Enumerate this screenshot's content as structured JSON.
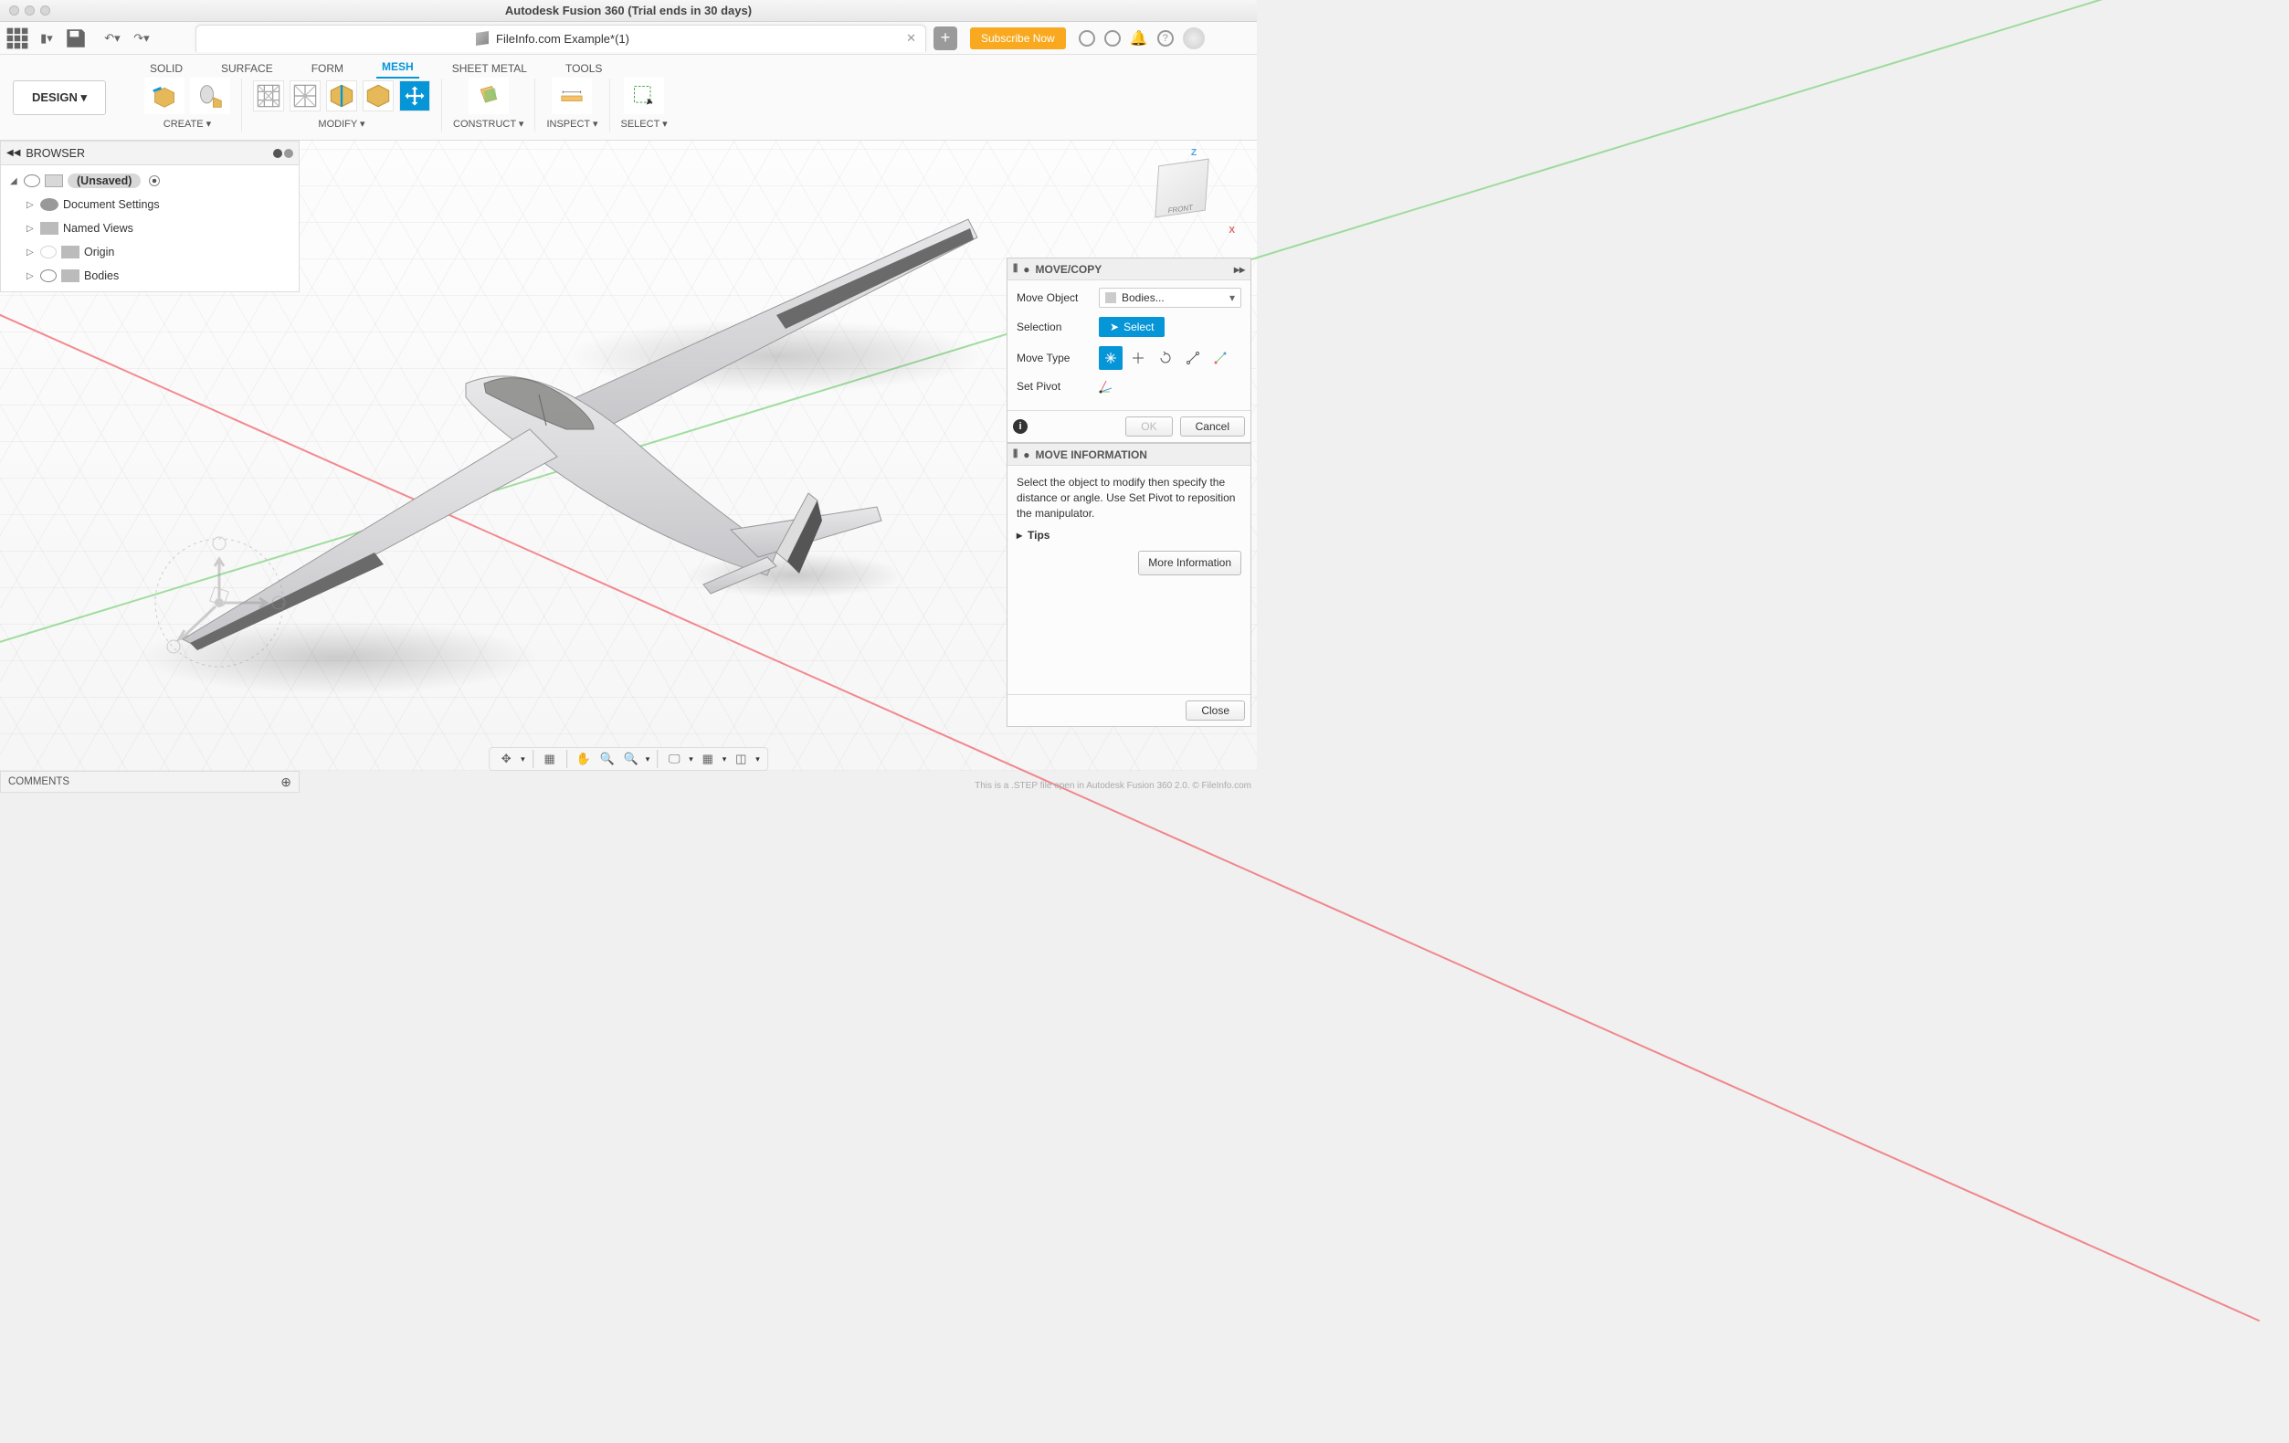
{
  "window": {
    "title": "Autodesk Fusion 360 (Trial ends in 30 days)"
  },
  "toolbar": {
    "doc_tab": "FileInfo.com Example*(1)",
    "subscribe": "Subscribe Now"
  },
  "workspace": {
    "label": "DESIGN"
  },
  "ribbon_tabs": [
    "SOLID",
    "SURFACE",
    "FORM",
    "MESH",
    "SHEET METAL",
    "TOOLS"
  ],
  "ribbon_active": 3,
  "ribbon_groups": {
    "create": "CREATE",
    "modify": "MODIFY",
    "construct": "CONSTRUCT",
    "inspect": "INSPECT",
    "select": "SELECT"
  },
  "browser": {
    "title": "BROWSER",
    "root": "(Unsaved)",
    "items": [
      {
        "label": "Document Settings"
      },
      {
        "label": "Named Views"
      },
      {
        "label": "Origin"
      },
      {
        "label": "Bodies"
      }
    ]
  },
  "viewcube": {
    "front": "FRONT",
    "z": "Z",
    "x": "X"
  },
  "move_panel": {
    "title": "MOVE/COPY",
    "rows": {
      "move_object": "Move Object",
      "move_object_val": "Bodies...",
      "selection": "Selection",
      "select_btn": "Select",
      "move_type": "Move Type",
      "set_pivot": "Set Pivot"
    },
    "ok": "OK",
    "cancel": "Cancel"
  },
  "info_panel": {
    "title": "MOVE INFORMATION",
    "body": "Select the object to modify then specify the distance or angle. Use Set Pivot to reposition the manipulator.",
    "tips": "Tips",
    "more": "More Information",
    "close": "Close"
  },
  "comments": {
    "label": "COMMENTS"
  },
  "status": "This is a .STEP file open in Autodesk Fusion 360 2.0. © FileInfo.com"
}
